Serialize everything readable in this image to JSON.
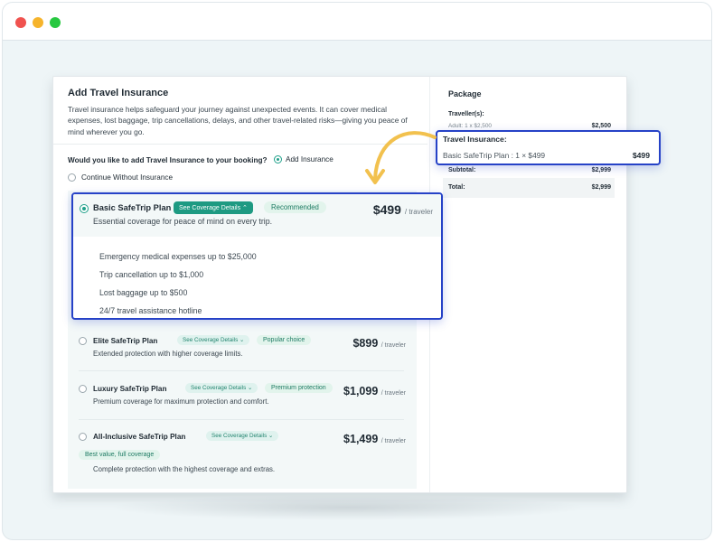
{
  "window": {
    "controls": [
      "close",
      "minimize",
      "maximize"
    ]
  },
  "insurance": {
    "title": "Add Travel Insurance",
    "intro": "Travel insurance helps safeguard your journey against unexpected events. It can cover medical expenses, lost baggage, trip cancellations, delays, and other travel-related risks—giving you peace of mind wherever you go.",
    "question": "Would you like to add Travel Insurance to your booking?",
    "option_add": "Add Insurance",
    "option_continue": "Continue Without Insurance",
    "selected_option": "add"
  },
  "plans": [
    {
      "name": "Basic SafeTrip Plan",
      "see_label": "See Coverage Details",
      "tag": "Recommended",
      "description": "Essential coverage for peace of mind on every trip.",
      "price": "$499",
      "per": "/ traveler",
      "selected": true,
      "features": [
        "Emergency medical expenses up to $25,000",
        "Trip cancellation up to $1,000",
        "Lost baggage up to $500",
        "24/7 travel assistance hotline"
      ]
    },
    {
      "name": "Elite SafeTrip Plan",
      "see_label": "See Coverage Details",
      "tag": "Popular choice",
      "description": "Extended protection with higher coverage limits.",
      "price": "$899",
      "per": "/ traveler"
    },
    {
      "name": "Luxury SafeTrip Plan",
      "see_label": "See Coverage Details",
      "tag": "Premium protection",
      "description": "Premium coverage for maximum protection and comfort.",
      "price": "$1,099",
      "per": "/ traveler"
    },
    {
      "name": "All-Inclusive SafeTrip Plan",
      "see_label": "See Coverage Details",
      "tag": "Best value, full coverage",
      "description": "Complete protection with the highest coverage and extras.",
      "price": "$1,499",
      "per": "/ traveler"
    }
  ],
  "package": {
    "title": "Package",
    "travellers_label": "Traveller(s):",
    "adult_line": "Adult: 1 x $2,500",
    "adult_value": "$2,500",
    "insurance_label": "Travel Insurance:",
    "insurance_line": "Basic SafeTrip Plan : 1 × $499",
    "insurance_value": "$499",
    "subtotal_label": "Subtotal:",
    "subtotal_value": "$2,999",
    "total_label": "Total:",
    "total_value": "$2,999"
  },
  "colors": {
    "accent": "#1e9a82",
    "highlight_border": "#2642c7",
    "arrow": "#f2c14e"
  },
  "icons": {
    "chevron": "chevron-down-icon",
    "chevron_up": "chevron-up-icon"
  }
}
